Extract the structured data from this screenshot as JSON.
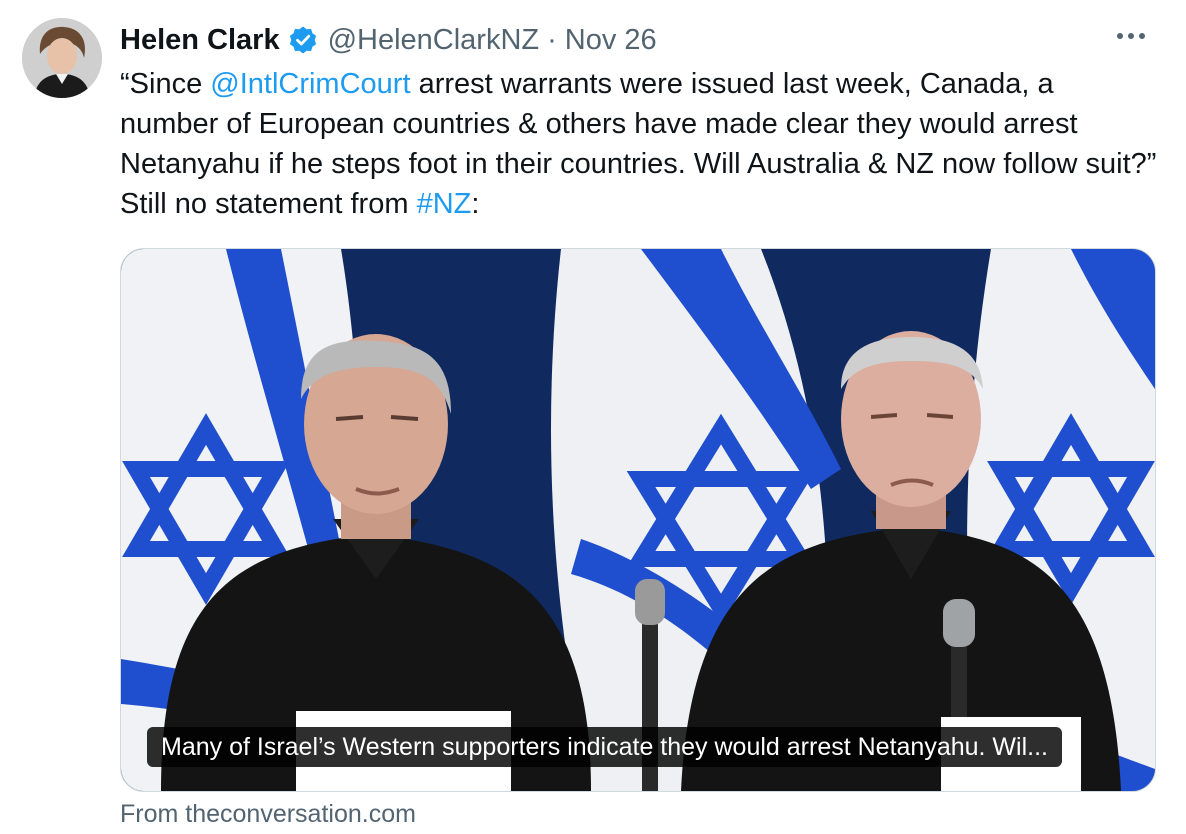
{
  "author": {
    "display_name": "Helen Clark",
    "handle": "@HelenClarkNZ",
    "separator": "·",
    "date": "Nov 26"
  },
  "tweet": {
    "text_1": "“Since ",
    "mention": "@IntlCrimCourt",
    "text_2": " arrest warrants were issued last week, Canada, a number of European countries & others have made clear they would arrest Netanyahu if he steps foot in their countries. Will Australia & NZ now follow suit?” Still no statement from ",
    "hashtag": "#NZ",
    "text_3": ":"
  },
  "media": {
    "caption": "Many of Israel’s Western supporters indicate they would arrest Netanyahu. Wil..."
  },
  "card": {
    "source": "From theconversation.com"
  },
  "colors": {
    "link": "#1d9bf0",
    "secondary_text": "#536471",
    "verified": "#1d9bf0",
    "flag_blue": "#1f4fcf",
    "backdrop": "#102a60"
  },
  "icons": {
    "verified": "verified-badge-icon",
    "more": "more-dots-icon"
  }
}
